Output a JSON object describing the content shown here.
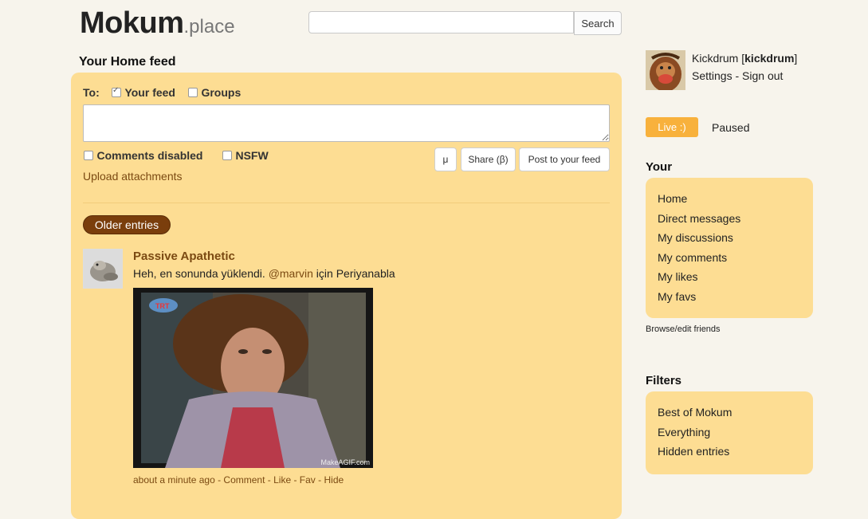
{
  "header": {
    "logo_main": "Mokum",
    "logo_suffix": ".place",
    "search_button": "Search"
  },
  "feed": {
    "title": "Your Home feed",
    "composer": {
      "to_label": "To:",
      "your_feed_label": "Your feed",
      "your_feed_checked": true,
      "groups_label": "Groups",
      "groups_checked": false,
      "comments_disabled_label": "Comments disabled",
      "nsfw_label": "NSFW",
      "upload_label": "Upload attachments",
      "mu_button": "μ",
      "share_button": "Share (β)",
      "post_button": "Post to your feed"
    },
    "older_entries": "Older entries",
    "entries": [
      {
        "author": "Passive Apathetic",
        "text_before": "Heh, en sonunda yüklendi. ",
        "mention": "@marvin",
        "text_after": " için Periyanabla",
        "image_watermark": "MakeAGIF.com",
        "meta": {
          "time": "about a minute ago",
          "sep": " - ",
          "comment": "Comment",
          "like": "Like",
          "fav": "Fav",
          "hide": "Hide"
        }
      }
    ]
  },
  "user": {
    "display_name": "Kickdrum",
    "username": "kickdrum",
    "settings": "Settings",
    "link_sep": " - ",
    "sign_out": "Sign out"
  },
  "live": {
    "live_label": "Live :)",
    "paused_label": "Paused",
    "accent": "#f8b13c"
  },
  "your_section": {
    "title": "Your",
    "items": [
      "Home",
      "Direct messages",
      "My discussions",
      "My comments",
      "My likes",
      "My favs"
    ],
    "browse_link": "Browse/edit friends"
  },
  "filters_section": {
    "title": "Filters",
    "items": [
      "Best of Mokum",
      "Everything",
      "Hidden entries"
    ]
  },
  "colors": {
    "panel": "#fddd93",
    "background": "#f7f4ec",
    "link": "#7b4a12",
    "older_button": "#7a3e0c"
  }
}
